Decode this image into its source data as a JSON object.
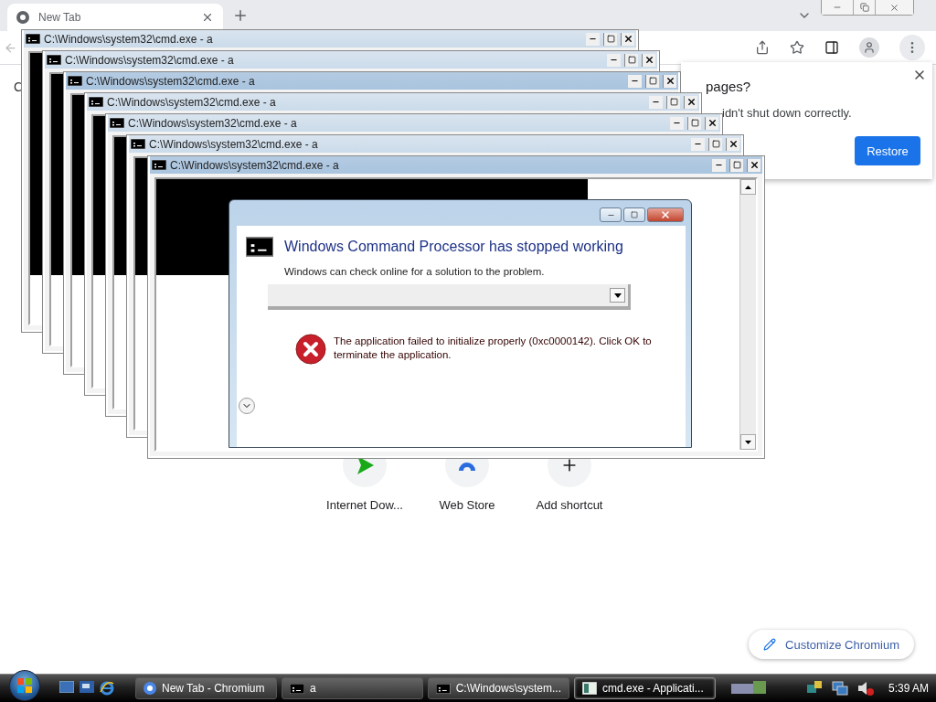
{
  "browser": {
    "tab": {
      "title": "New Tab"
    },
    "side_text": "C",
    "restore_bubble": {
      "title": "pages?",
      "message": "idn't shut down correctly.",
      "button": "Restore"
    },
    "shortcuts": [
      {
        "label": "Internet Dow...",
        "kind": "play"
      },
      {
        "label": "Web Store",
        "kind": "store"
      },
      {
        "label": "Add shortcut",
        "kind": "add"
      }
    ],
    "customize_button": "Customize Chromium"
  },
  "console_windows": [
    {
      "title": "C:\\Windows\\system32\\cmd.exe - a",
      "active": false
    },
    {
      "title": "C:\\Windows\\system32\\cmd.exe - a",
      "active": false
    },
    {
      "title": "C:\\Windows\\system32\\cmd.exe - a",
      "active": true
    },
    {
      "title": "C:\\Windows\\system32\\cmd.exe - a",
      "active": false
    },
    {
      "title": "C:\\Windows\\system32\\cmd.exe - a",
      "active": false
    },
    {
      "title": "C:\\Windows\\system32\\cmd.exe - a",
      "active": false
    },
    {
      "title": "C:\\Windows\\system32\\cmd.exe - a",
      "active": true
    }
  ],
  "error_dialog": {
    "heading": "Windows Command Processor has stopped working",
    "subtext": "Windows can check online for a solution to the problem.",
    "message": "The application failed to initialize properly (0xc0000142). Click OK to terminate the application."
  },
  "taskbar": {
    "items": [
      {
        "label": "New Tab - Chromium",
        "kind": "browser",
        "selected": false
      },
      {
        "label": "a",
        "kind": "console",
        "selected": false
      },
      {
        "label": "C:\\Windows\\system...",
        "kind": "console",
        "selected": false
      },
      {
        "label": "cmd.exe - Applicati...",
        "kind": "app",
        "selected": true
      }
    ],
    "clock": "5:39 AM"
  }
}
